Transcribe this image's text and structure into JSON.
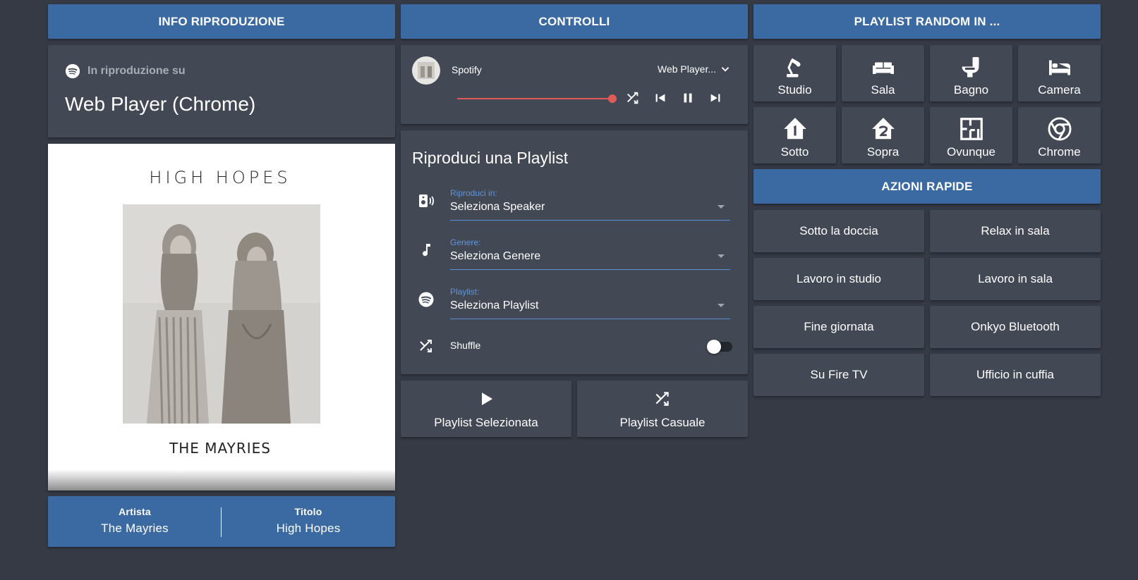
{
  "columns": {
    "info": {
      "header": "INFO RIPRODUZIONE"
    },
    "controls": {
      "header": "CONTROLLI"
    },
    "random": {
      "header": "PLAYLIST RANDOM IN ..."
    },
    "quick": {
      "header": "AZIONI RAPIDE"
    }
  },
  "now_playing": {
    "label": "In riproduzione su",
    "device": "Web Player (Chrome)"
  },
  "album_art": {
    "title_text": "HIGH HOPES",
    "artist_text": "THE MAYRIES"
  },
  "track": {
    "artist_label": "Artista",
    "artist": "The Mayries",
    "title_label": "Titolo",
    "title": "High Hopes"
  },
  "player": {
    "source": "Spotify",
    "output": "Web Player...",
    "progress": 1.0
  },
  "playlist_form": {
    "title": "Riproduci una Playlist",
    "fields": [
      {
        "label": "Riproduci in:",
        "value": "Seleziona Speaker",
        "icon": "speaker-icon"
      },
      {
        "label": "Genere:",
        "value": "Seleziona Genere",
        "icon": "music-note-icon"
      },
      {
        "label": "Playlist:",
        "value": "Seleziona Playlist",
        "icon": "spotify-icon"
      }
    ],
    "shuffle_label": "Shuffle",
    "shuffle_on": false
  },
  "action_buttons": {
    "selected": "Playlist Selezionata",
    "random": "Playlist Casuale"
  },
  "rooms": [
    {
      "label": "Studio",
      "icon": "desk-lamp-icon"
    },
    {
      "label": "Sala",
      "icon": "sofa-icon"
    },
    {
      "label": "Bagno",
      "icon": "toilet-icon"
    },
    {
      "label": "Camera",
      "icon": "bed-icon"
    },
    {
      "label": "Sotto",
      "icon": "home-floor-1-icon"
    },
    {
      "label": "Sopra",
      "icon": "home-floor-2-icon"
    },
    {
      "label": "Ovunque",
      "icon": "floor-plan-icon"
    },
    {
      "label": "Chrome",
      "icon": "chrome-icon"
    }
  ],
  "quick_actions": [
    "Sotto la doccia",
    "Relax in sala",
    "Lavoro in studio",
    "Lavoro in sala",
    "Fine giornata",
    "Onkyo Bluetooth",
    "Su Fire TV",
    "Ufficio in cuffia"
  ],
  "colors": {
    "background": "#353a45",
    "card": "#424854",
    "header": "#3b6aa3",
    "accent": "#5c96e0",
    "progress": "#e05a5a"
  }
}
